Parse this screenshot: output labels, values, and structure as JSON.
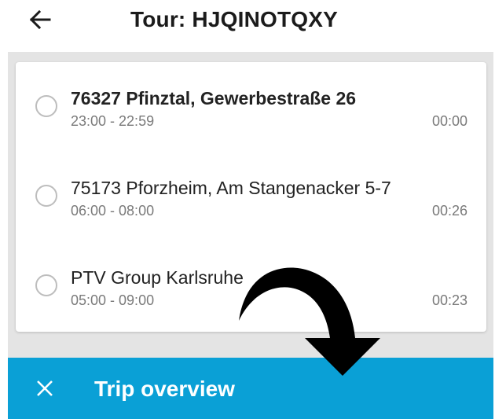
{
  "header": {
    "title": "Tour: HJQINOTQXY",
    "back_icon": "arrow-left-icon"
  },
  "stops": [
    {
      "name": "76327 Pfinztal, Gewerbestraße 26",
      "time_window": "23:00 - 22:59",
      "duration": "00:00",
      "bold": true
    },
    {
      "name": "75173 Pforzheim, Am Stangenacker 5-7",
      "time_window": "06:00 - 08:00",
      "duration": "00:26",
      "bold": false
    },
    {
      "name": "PTV Group Karlsruhe",
      "time_window": "05:00 - 09:00",
      "duration": "00:23",
      "bold": false
    }
  ],
  "bottom_bar": {
    "label": "Trip overview",
    "close_icon": "close-icon",
    "color": "#0aa0d6"
  },
  "overlay": {
    "icon": "curved-arrow-down-icon",
    "color": "#000000"
  }
}
